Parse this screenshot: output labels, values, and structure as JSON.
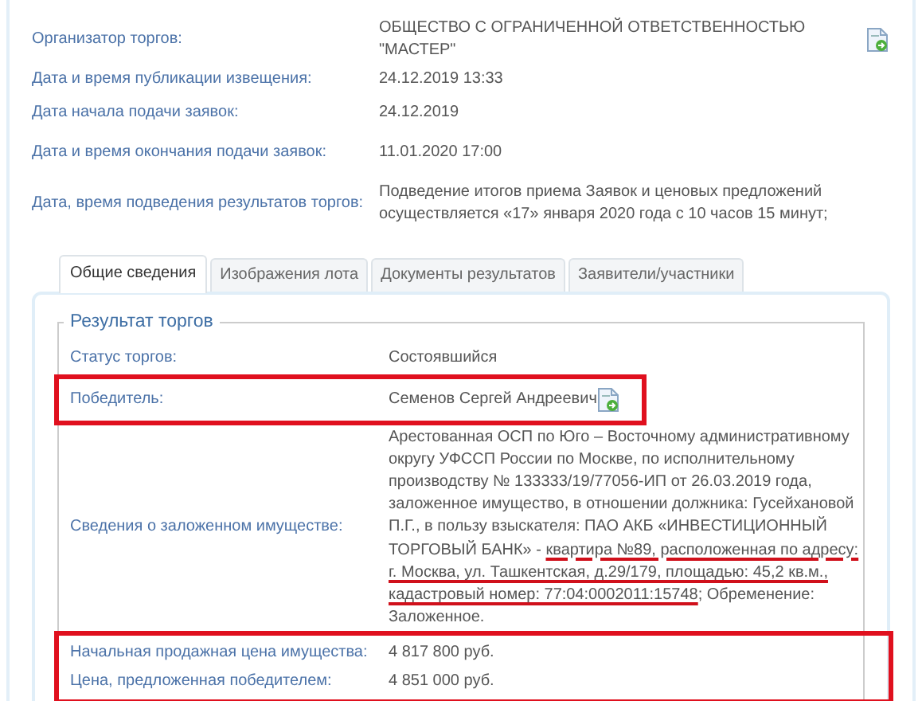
{
  "details": [
    {
      "label": "Организатор торгов:",
      "value": "ОБЩЕСТВО С ОГРАНИЧЕННОЙ ОТВЕТСТВЕННОСТЬЮ \"МАСТЕР\"",
      "has_icon": true
    },
    {
      "label": "Дата и время публикации извещения:",
      "value": "24.12.2019 13:33",
      "has_icon": false
    },
    {
      "label": "Дата начала подачи заявок:",
      "value": "24.12.2019",
      "has_icon": false
    },
    {
      "label": "Дата и время окончания подачи заявок:",
      "value": "11.01.2020 17:00",
      "has_icon": false
    },
    {
      "label": "Дата, время подведения результатов торгов:",
      "value": "Подведение итогов приема Заявок и ценовых предложений осуществляется «17» января 2020 года с 10 часов 15 минут;",
      "has_icon": false
    }
  ],
  "tabs": [
    {
      "label": "Общие сведения",
      "selected": true
    },
    {
      "label": "Изображения лота",
      "selected": false
    },
    {
      "label": "Документы результатов",
      "selected": false
    },
    {
      "label": "Заявители/участники",
      "selected": false
    }
  ],
  "result": {
    "title": "Результат торгов",
    "rows": [
      {
        "label": "Статус торгов:",
        "segments": [
          {
            "text": "Состоявшийся",
            "underlined": false
          }
        ],
        "has_icon": false,
        "highlighted": false
      },
      {
        "label": "Победитель:",
        "segments": [
          {
            "text": "Семенов Сергей Андреевич",
            "underlined": false
          }
        ],
        "has_icon": true,
        "highlighted": true
      },
      {
        "label": "Сведения о заложенном имуществе:",
        "segments": [
          {
            "text": "Арестованная ОСП по Юго – Восточному административному округу УФССП России по Москве, по исполнительному производству № 133333/19/77056-ИП от 26.03.2019 года, заложенное имущество, в отношении должника: Гусейхановой П.Г., в пользу взыскателя: ПАО АКБ «ИНВЕСТИЦИОННЫЙ ТОРГОВЫЙ БАНК» - ",
            "underlined": false
          },
          {
            "text": "квартира №89, расположенная по адресу: г. Москва, ул. Ташкентская, д.29/179, площадью: 45,2 кв.м., кадастровый номер: 77:04:0002011:15748",
            "underlined": true
          },
          {
            "text": "; Обременение: Заложенное.",
            "underlined": false
          }
        ],
        "has_icon": false,
        "highlighted": false
      },
      {
        "label": "Начальная продажная цена имущества:",
        "segments": [
          {
            "text": "4 817 800 руб.",
            "underlined": false
          }
        ],
        "has_icon": false,
        "highlighted": true
      },
      {
        "label": "Цена, предложенная победителем:",
        "segments": [
          {
            "text": "4 851 000 руб.",
            "underlined": false
          }
        ],
        "has_icon": false,
        "highlighted": true
      }
    ]
  }
}
